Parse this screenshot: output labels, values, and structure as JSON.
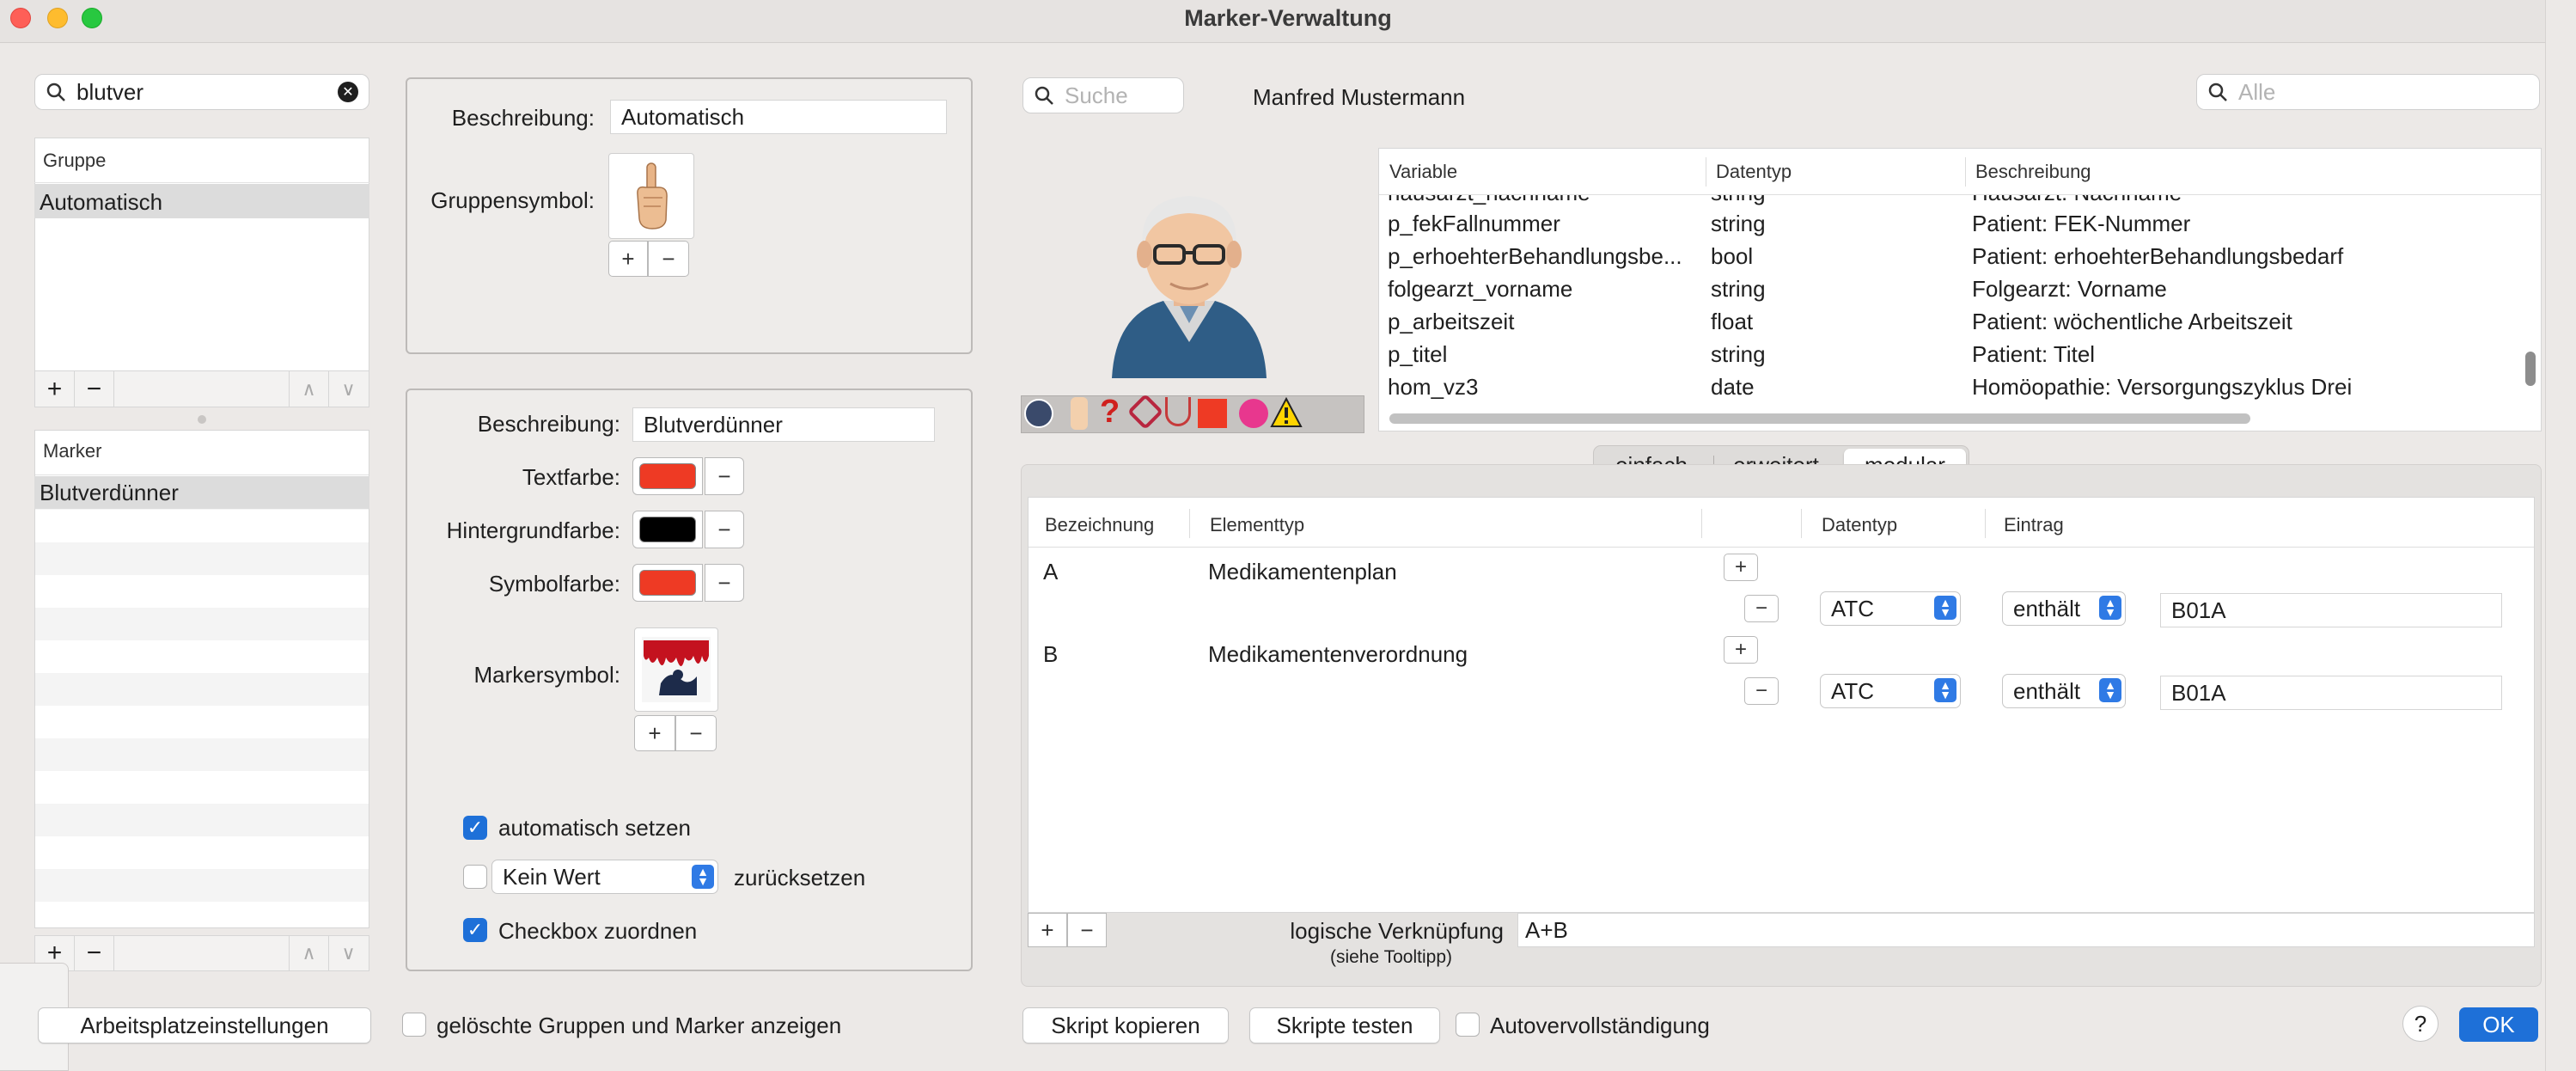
{
  "window": {
    "title": "Marker-Verwaltung"
  },
  "colors": {
    "red": "#ee3a24",
    "black": "#000000",
    "accent": "#1e70d8"
  },
  "left": {
    "search": {
      "value": "blutver"
    },
    "group_header": "Gruppe",
    "groups": [
      "Automatisch"
    ],
    "marker_header": "Marker",
    "markers": [
      "Blutverdünner"
    ],
    "plus": "+",
    "minus": "−",
    "up": "∧",
    "down": "∨"
  },
  "group_panel": {
    "beschreibung_label": "Beschreibung:",
    "beschreibung_value": "Automatisch",
    "gruppensymbol_label": "Gruppensymbol:",
    "plus": "+",
    "minus": "−"
  },
  "marker_panel": {
    "beschreibung_label": "Beschreibung:",
    "beschreibung_value": "Blutverdünner",
    "textfarbe_label": "Textfarbe:",
    "hintergrundfarbe_label": "Hintergrundfarbe:",
    "symbolfarbe_label": "Symbolfarbe:",
    "markersymbol_label": "Markersymbol:",
    "minus": "−",
    "plus": "+",
    "auto_label": "automatisch setzen",
    "kein_wert": "Kein Wert",
    "zurueck_label": "zurücksetzen",
    "checkbox_label": "Checkbox zuordnen"
  },
  "patient": {
    "search_placeholder": "Suche",
    "name": "Manfred Mustermann",
    "alle_placeholder": "Alle"
  },
  "variables": {
    "headers": [
      "Variable",
      "Datentyp",
      "Beschreibung"
    ],
    "partial": {
      "var": "hausarzt_nachname",
      "type": "string",
      "desc": "Hausarzt: Nachname"
    },
    "rows": [
      {
        "var": "p_fekFallnummer",
        "type": "string",
        "desc": "Patient: FEK-Nummer"
      },
      {
        "var": "p_erhoehterBehandlungsbe...",
        "type": "bool",
        "desc": "Patient: erhoehterBehandlungsbedarf"
      },
      {
        "var": "folgearzt_vorname",
        "type": "string",
        "desc": "Folgearzt: Vorname"
      },
      {
        "var": "p_arbeitszeit",
        "type": "float",
        "desc": "Patient: wöchentliche Arbeitszeit"
      },
      {
        "var": "p_titel",
        "type": "string",
        "desc": "Patient: Titel"
      },
      {
        "var": "hom_vz3",
        "type": "date",
        "desc": "Homöopathie: Versorgungszyklus Drei"
      }
    ]
  },
  "tabs": [
    "einfach",
    "erweitert",
    "modular"
  ],
  "modular": {
    "headers": [
      "Bezeichnung",
      "Elementtyp",
      "Datentyp",
      "Eintrag"
    ],
    "rows": [
      {
        "bez": "A",
        "typ": "Medikamentenplan",
        "datentyp": "ATC",
        "op": "enthält",
        "value": "B01A"
      },
      {
        "bez": "B",
        "typ": "Medikamentenverordnung",
        "datentyp": "ATC",
        "op": "enthält",
        "value": "B01A"
      }
    ],
    "logik_label": "logische Verknüpfung",
    "logik_hint": "(siehe Tooltipp)",
    "logik_value": "A+B",
    "plus": "+",
    "minus": "−"
  },
  "bottom": {
    "arbeitsplatz": "Arbeitsplatzeinstellungen",
    "geloeschte": "gelöschte Gruppen und Marker anzeigen",
    "skript_kopieren": "Skript kopieren",
    "skripte_testen": "Skripte testen",
    "autovervoll": "Autovervollständigung",
    "help": "?",
    "ok": "OK"
  }
}
